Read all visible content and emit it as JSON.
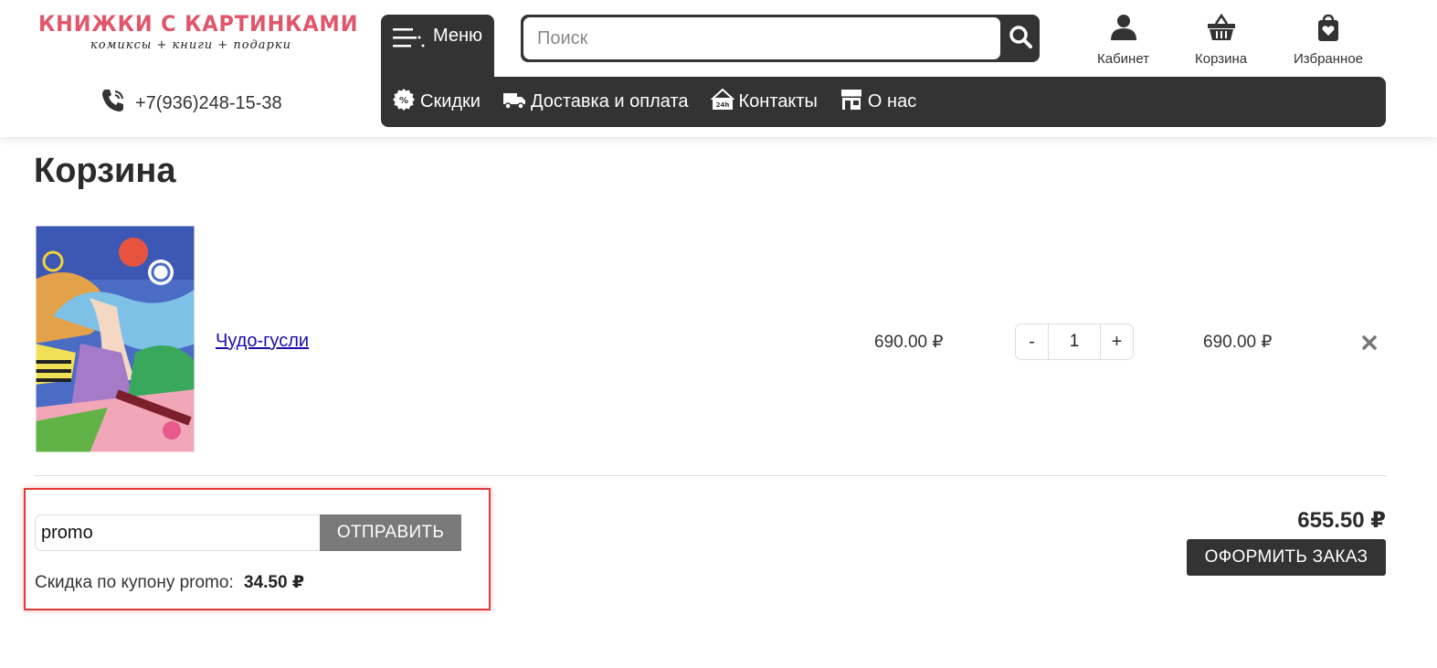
{
  "header": {
    "logo_title": "КНИЖКИ С КАРТИНКАМИ",
    "logo_subtitle": "комиксы + книги + подарки",
    "phone": "+7(936)248-15-38",
    "menu_label": "Меню",
    "search_placeholder": "Поиск",
    "account_label": "Кабинет",
    "cart_label": "Корзина",
    "favorites_label": "Избранное",
    "nav": [
      {
        "label": "Скидки",
        "icon": "discount-icon"
      },
      {
        "label": "Доставка и оплата",
        "icon": "truck-icon"
      },
      {
        "label": "Контакты",
        "icon": "contacts-24h-icon"
      },
      {
        "label": "О нас",
        "icon": "store-icon"
      }
    ]
  },
  "main": {
    "title": "Корзина",
    "item": {
      "name": "Чудо-гусли",
      "price": "690.00 ₽",
      "quantity": "1",
      "minus": "-",
      "plus": "+",
      "total": "690.00 ₽"
    },
    "coupon": {
      "value": "promo",
      "button": "ОТПРАВИТЬ",
      "discount_label": "Скидка по купону promo:",
      "discount_value": "34.50 ₽"
    },
    "grand_total": "655.50 ₽",
    "checkout_button": "ОФОРМИТЬ ЗАКАЗ"
  },
  "colors": {
    "brand": "#e0566a",
    "dark": "#333333",
    "link": "#1a0dab",
    "highlight": "#e23b3b"
  }
}
